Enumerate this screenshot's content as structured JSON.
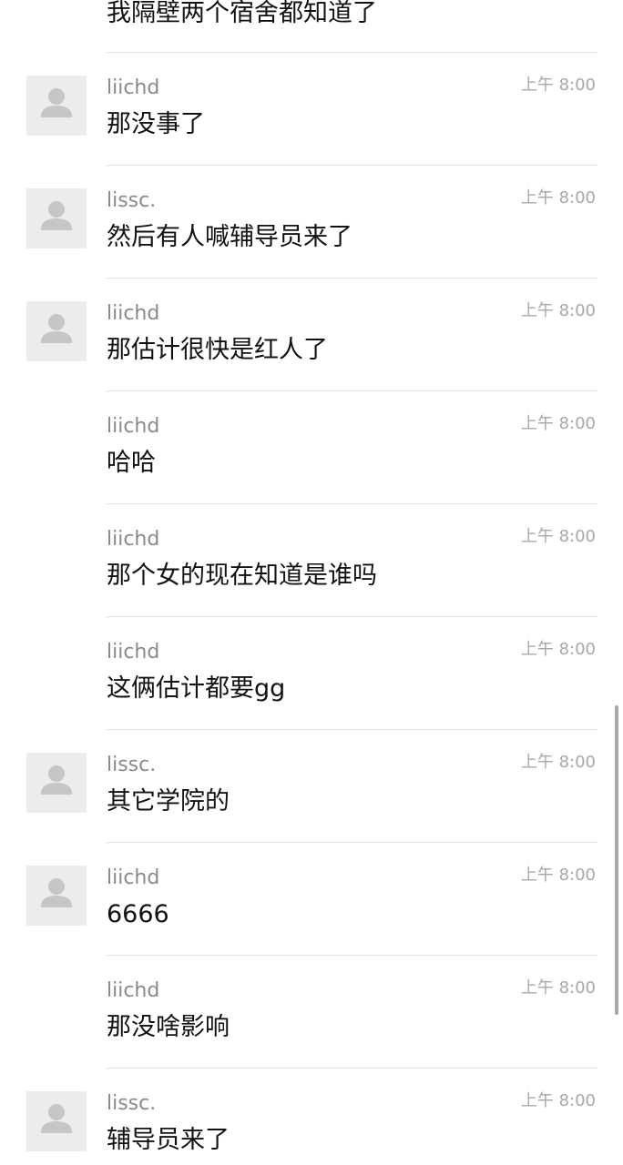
{
  "top_message": {
    "text": "我隔壁两个宿舍都知道了"
  },
  "messages": [
    {
      "sender": "liichd",
      "time": "上午 8:00",
      "text": "那没事了",
      "has_avatar": true
    },
    {
      "sender": "lissc.",
      "time": "上午 8:00",
      "text": "然后有人喊辅导员来了",
      "has_avatar": true
    },
    {
      "sender": "liichd",
      "time": "上午 8:00",
      "text": "那估计很快是红人了",
      "has_avatar": true
    },
    {
      "sender": "liichd",
      "time": "上午 8:00",
      "text": "哈哈",
      "has_avatar": false
    },
    {
      "sender": "liichd",
      "time": "上午 8:00",
      "text": "那个女的现在知道是谁吗",
      "has_avatar": false
    },
    {
      "sender": "liichd",
      "time": "上午 8:00",
      "text": "这俩估计都要gg",
      "has_avatar": false
    },
    {
      "sender": "lissc.",
      "time": "上午 8:00",
      "text": "其它学院的",
      "has_avatar": true
    },
    {
      "sender": "liichd",
      "time": "上午 8:00",
      "text": "6666",
      "has_avatar": true
    },
    {
      "sender": "liichd",
      "time": "上午 8:00",
      "text": "那没啥影响",
      "has_avatar": false
    },
    {
      "sender": "lissc.",
      "time": "上午 8:00",
      "text": "辅导员来了",
      "has_avatar": true
    }
  ],
  "icons": {
    "avatar": "default-user-icon"
  },
  "colors": {
    "background": "#ffffff",
    "message_text": "#111111",
    "sender_name": "#8a8a8a",
    "timestamp": "#a8a8a8",
    "separator": "#e2e2e2",
    "avatar_bg": "#ececec",
    "avatar_figure": "#c6c6c6"
  }
}
